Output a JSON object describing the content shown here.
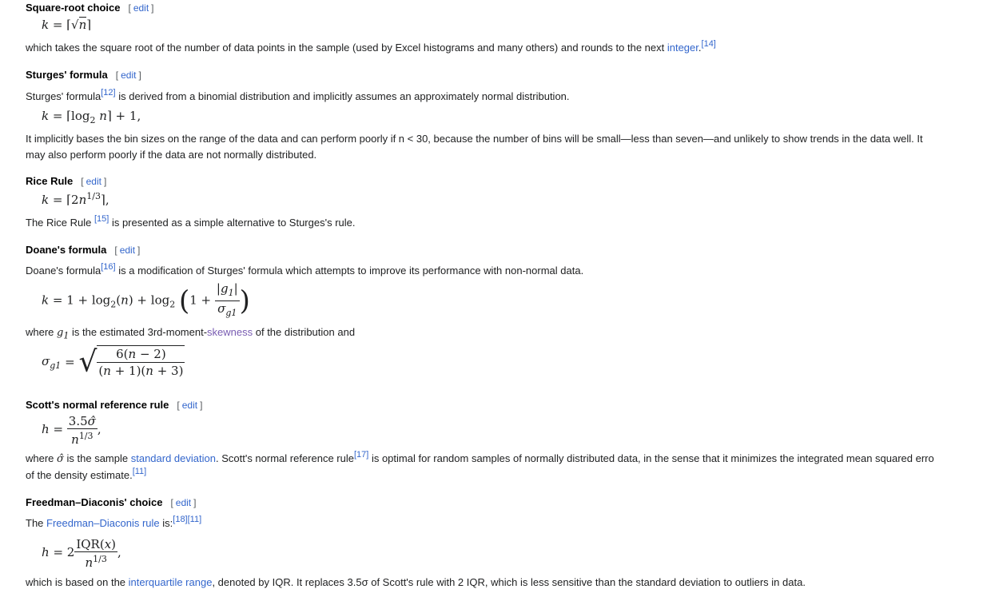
{
  "edit_label": "edit",
  "s1": {
    "title": "Square-root choice",
    "text": "which takes the square root of the number of data points in the sample (used by Excel histograms and many others) and rounds to the next ",
    "link": "integer",
    "tail": ".",
    "ref": "[14]"
  },
  "s2": {
    "title": "Sturges' formula",
    "intro_a": "Sturges' formula",
    "ref": "[12]",
    "intro_b": " is derived from a binomial distribution and implicitly assumes an approximately normal distribution.",
    "text_line1": "It implicitly bases the bin sizes on the range of the data and can perform poorly if n < 30, because the number of bins will be small—less than seven—and unlikely to show trends in the data well. It",
    "text_line2": "may also perform poorly if the data are not normally distributed."
  },
  "s3": {
    "title": "Rice Rule",
    "text_a": "The Rice Rule ",
    "ref": "[15]",
    "text_b": " is presented as a simple alternative to Sturges's rule."
  },
  "s4": {
    "title": "Doane's formula",
    "intro_a": "Doane's formula",
    "ref": "[16]",
    "intro_b": " is a modification of Sturges' formula which attempts to improve its performance with non-normal data.",
    "where_a": "where ",
    "where_b": " is the estimated 3rd-moment-",
    "where_link": "skewness",
    "where_c": " of the distribution and"
  },
  "s5": {
    "title": "Scott's normal reference rule",
    "text_a": "where ",
    "text_b": " is the sample ",
    "link": "standard deviation",
    "text_c": ". Scott's normal reference rule",
    "ref": "[17]",
    "text_d": " is optimal for random samples of normally distributed data, in the sense that it minimizes the integrated mean squared erro",
    "line2": "of the density estimate.",
    "ref2": "[11]"
  },
  "s6": {
    "title": "Freedman–Diaconis' choice",
    "intro_a": "The ",
    "link": "Freedman–Diaconis rule",
    "intro_b": " is:",
    "ref1": "[18]",
    "ref2": "[11]",
    "text_a": "which is based on the ",
    "link2": "interquartile range",
    "text_b": ", denoted by IQR. It replaces 3.5σ of Scott's rule with 2 IQR, which is less sensitive than the standard deviation to outliers in data."
  }
}
